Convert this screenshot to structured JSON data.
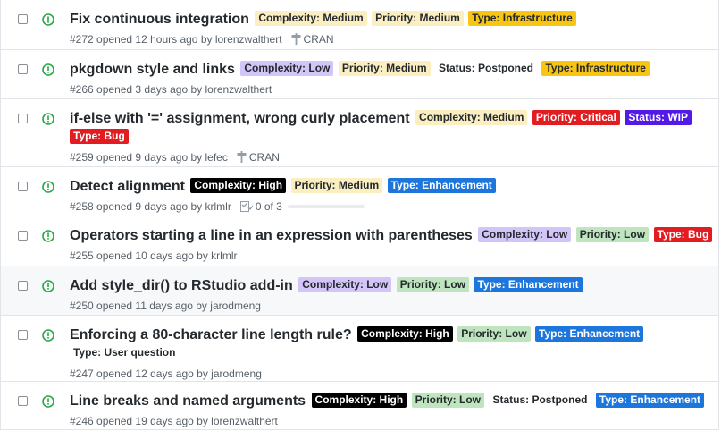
{
  "colors": {
    "open_icon": "#28a745",
    "label_styles": {
      "Complexity: Medium": {
        "bg": "#fbeec1",
        "fg": "#24292e"
      },
      "Complexity: Low": {
        "bg": "#d4c5f9",
        "fg": "#24292e"
      },
      "Complexity: High": {
        "bg": "#000000",
        "fg": "#ffffff"
      },
      "Priority: Medium": {
        "bg": "#fbeec1",
        "fg": "#24292e"
      },
      "Priority: Low": {
        "bg": "#bfe5bf",
        "fg": "#24292e"
      },
      "Priority: Critical": {
        "bg": "#e11d21",
        "fg": "#ffffff"
      },
      "Status: Postponed": {
        "bg": "#ffffff",
        "fg": "#24292e"
      },
      "Status: WIP": {
        "bg": "#5319e7",
        "fg": "#ffffff"
      },
      "Type: Infrastructure": {
        "bg": "#f9c513",
        "fg": "#24292e"
      },
      "Type: Bug": {
        "bg": "#e11d21",
        "fg": "#ffffff"
      },
      "Type: Enhancement": {
        "bg": "#1d76db",
        "fg": "#ffffff"
      },
      "Type: User question": {
        "bg": "#ffffff",
        "fg": "#24292e"
      }
    }
  },
  "issues": [
    {
      "title": "Fix continuous integration",
      "labels": [
        "Complexity: Medium",
        "Priority: Medium",
        "Type: Infrastructure"
      ],
      "number": "#272",
      "opened": "opened 12 hours ago by",
      "author": "lorenzwalthert",
      "milestone": "CRAN",
      "icon": "issue-opened-icon"
    },
    {
      "title": "pkgdown style and links",
      "labels": [
        "Complexity: Low",
        "Priority: Medium",
        "Status: Postponed",
        "Type: Infrastructure"
      ],
      "number": "#266",
      "opened": "opened 3 days ago by",
      "author": "lorenzwalthert"
    },
    {
      "title": "if-else with '=' assignment, wrong curly placement",
      "labels": [
        "Complexity: Medium",
        "Priority: Critical",
        "Status: WIP",
        "Type: Bug"
      ],
      "number": "#259",
      "opened": "opened 9 days ago by",
      "author": "lefec",
      "milestone": "CRAN"
    },
    {
      "title": "Detect alignment",
      "labels": [
        "Complexity: High",
        "Priority: Medium",
        "Type: Enhancement"
      ],
      "number": "#258",
      "opened": "opened 9 days ago by",
      "author": "krlmlr",
      "tasks": "0 of 3",
      "task_progress": 0
    },
    {
      "title": "Operators starting a line in an expression with parentheses",
      "labels": [
        "Complexity: Low",
        "Priority: Low",
        "Type: Bug"
      ],
      "number": "#255",
      "opened": "opened 10 days ago by",
      "author": "krlmlr"
    },
    {
      "title": "Add style_dir() to RStudio add-in",
      "labels": [
        "Complexity: Low",
        "Priority: Low",
        "Type: Enhancement"
      ],
      "number": "#250",
      "opened": "opened 11 days ago by",
      "author": "jarodmeng",
      "highlighted": true
    },
    {
      "title": "Enforcing a 80-character line length rule?",
      "labels": [
        "Complexity: High",
        "Priority: Low",
        "Type: Enhancement",
        "Type: User question"
      ],
      "number": "#247",
      "opened": "opened 12 days ago by",
      "author": "jarodmeng"
    },
    {
      "title": "Line breaks and named arguments",
      "labels": [
        "Complexity: High",
        "Priority: Low",
        "Status: Postponed",
        "Type: Enhancement"
      ],
      "number": "#246",
      "opened": "opened 19 days ago by",
      "author": "lorenzwalthert"
    }
  ]
}
